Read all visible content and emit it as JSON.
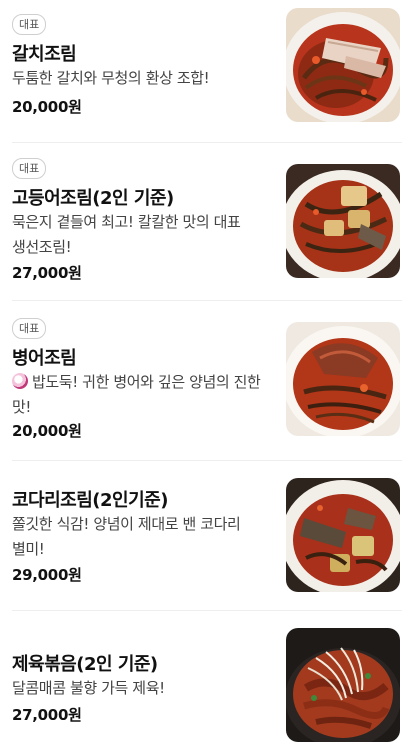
{
  "items": [
    {
      "badge": "대표",
      "name": "갈치조림",
      "desc": "두툼한 갈치와 무청의 환상 조합!",
      "price": "20,000원"
    },
    {
      "badge": "대표",
      "name": "고등어조림(2인 기준)",
      "desc": "묵은지 곁들여 최고! 칼칼한 맛의 대표 생선조림!",
      "price": "27,000원"
    },
    {
      "badge": "대표",
      "name": "병어조림",
      "desc": "밥도둑! 귀한 병어와 깊은 양념의 진한 맛!",
      "price": "20,000원"
    },
    {
      "name": "코다리조림(2인기준)",
      "desc": "쫄깃한 식감! 양념이 제대로 밴 코다리 별미!",
      "price": "29,000원"
    },
    {
      "name": "제육볶음(2인 기준)",
      "desc": "달콤매콤 불향 가득 제육!",
      "price": "27,000원"
    }
  ]
}
